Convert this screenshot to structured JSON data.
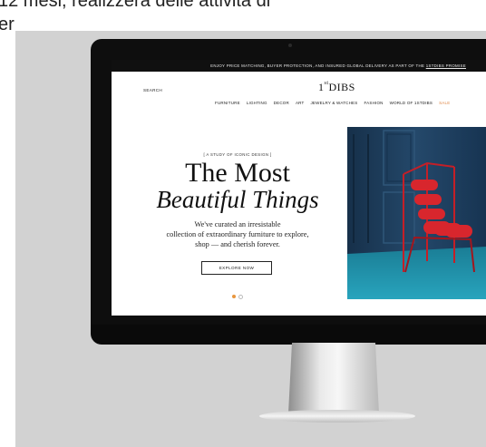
{
  "caption": {
    "line1": "12 mesi, realizzerà delle attività di",
    "line2": "er"
  },
  "promo": {
    "text": "ENJOY PRICE MATCHING, BUYER PROTECTION, AND INSURED GLOBAL DELIVERY AS PART OF THE ",
    "link": "1STDIBS PROMISE"
  },
  "header": {
    "search": "SEARCH",
    "logo": "1stDIBS"
  },
  "nav": {
    "items": [
      "FURNITURE",
      "LIGHTING",
      "DECOR",
      "ART",
      "JEWELRY & WATCHES",
      "FASHION",
      "WORLD OF 1STDIBS",
      "SALE"
    ]
  },
  "hero": {
    "label": "[ A STUDY OF ICONIC DESIGN ]",
    "title_line1": "The Most",
    "title_line2": "Beautiful Things",
    "subtitle_line1": "We've curated an irresistable",
    "subtitle_line2": "collection of extraordinary furniture to explore,",
    "subtitle_line3": "shop — and cherish forever.",
    "cta": "EXPLORE NOW"
  },
  "carousel": {
    "active_index": 0,
    "count": 2
  },
  "colors": {
    "sale": "#e08a4a",
    "dot_active": "#e8963e",
    "chair": "#d2232a",
    "wall": "#1d3a52",
    "floor": "#1f8ca3"
  },
  "icons": {
    "logo_mark": "1stdibs-logo"
  }
}
